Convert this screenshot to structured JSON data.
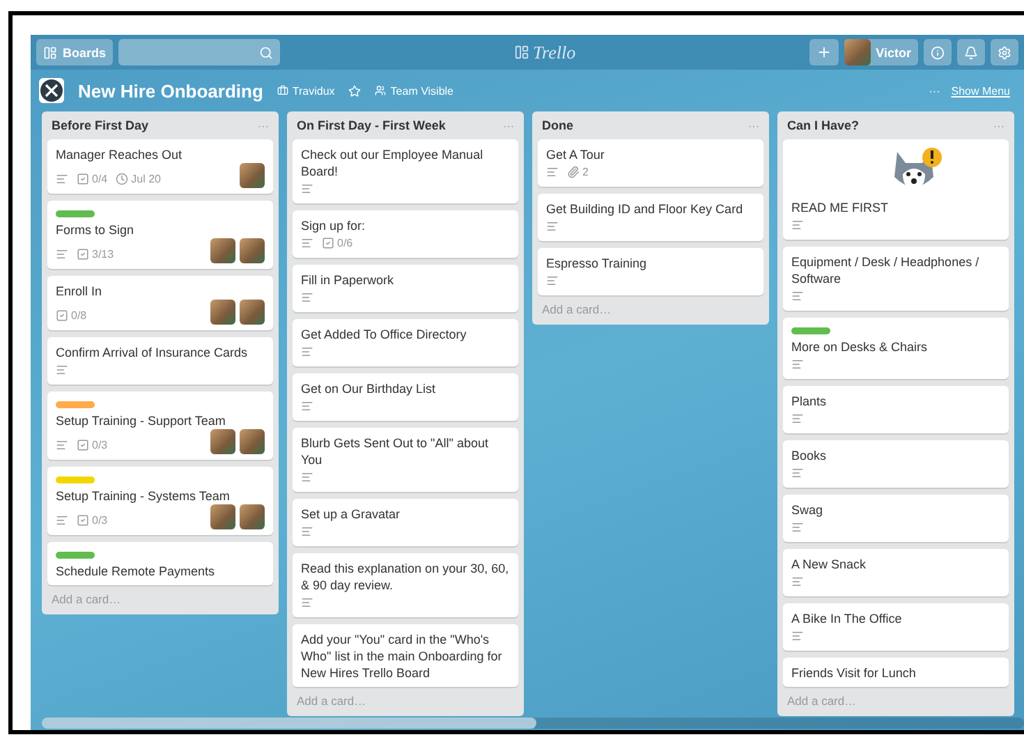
{
  "header": {
    "boards_button": "Boards",
    "logo": "Trello",
    "user": "Victor"
  },
  "board": {
    "title": "New Hire Onboarding",
    "team": "Travidux",
    "starred": false,
    "visibility": "Team Visible",
    "menu_dots": "···",
    "show_menu": "Show Menu"
  },
  "lists": [
    {
      "title": "Before First Day",
      "menu": "···",
      "add_card": "Add a card…",
      "cards": [
        {
          "title": "Manager Reaches Out",
          "description": true,
          "checklist": "0/4",
          "due": "Jul 20",
          "members": [
            {
              "kind": "photo"
            }
          ]
        },
        {
          "label": {
            "color": "#61bd4f"
          },
          "title": "Forms to Sign",
          "description": true,
          "checklist": "3/13",
          "members": [
            {
              "kind": "photo"
            },
            {
              "kind": "photo"
            }
          ]
        },
        {
          "title": "Enroll In",
          "description": false,
          "checklist": "0/8",
          "members": [
            {
              "kind": "photo"
            },
            {
              "kind": "photo"
            }
          ]
        },
        {
          "title": "Confirm Arrival of Insurance Cards",
          "description": true
        },
        {
          "label": {
            "color": "#ffab4a"
          },
          "title": "Setup Training - Support Team",
          "description": true,
          "checklist": "0/3",
          "members": [
            {
              "kind": "photo"
            },
            {
              "kind": "photo"
            }
          ]
        },
        {
          "label": {
            "color": "#f2d600"
          },
          "title": "Setup Training - Systems Team",
          "description": true,
          "checklist": "0/3",
          "members": [
            {
              "kind": "photo"
            },
            {
              "kind": "photo"
            }
          ]
        },
        {
          "label": {
            "color": "#61bd4f"
          },
          "title": "Schedule Remote Payments",
          "description": false
        }
      ]
    },
    {
      "title": "On First Day - First Week",
      "menu": "···",
      "add_card": "Add a card…",
      "cards": [
        {
          "title": "Check out our Employee Manual Board!",
          "description": true
        },
        {
          "title": "Sign up for:",
          "description": true,
          "checklist": "0/6"
        },
        {
          "title": "Fill in Paperwork",
          "description": true
        },
        {
          "title": "Get Added To Office Directory",
          "description": true
        },
        {
          "title": "Get on Our Birthday List",
          "description": true
        },
        {
          "title": "Blurb Gets Sent Out to \"All\" about You",
          "description": true
        },
        {
          "title": "Set up a Gravatar",
          "description": true
        },
        {
          "title": "Read this explanation on your 30, 60, & 90 day review.",
          "description": true
        },
        {
          "title": "Add your \"You\" card in the \"Who's Who\" list in the main Onboarding for New Hires Trello Board",
          "description": false
        }
      ]
    },
    {
      "title": "Done",
      "menu": "···",
      "add_card": "Add a card…",
      "cards": [
        {
          "title": "Get A Tour",
          "description": true,
          "attachments": "2"
        },
        {
          "title": "Get Building ID and Floor Key Card",
          "description": true
        },
        {
          "title": "Espresso Training",
          "description": true
        }
      ]
    },
    {
      "title": "Can I Have?",
      "menu": "···",
      "add_card": "Add a card…",
      "cards": [
        {
          "title": "READ ME FIRST",
          "description": true,
          "sticker": true
        },
        {
          "title": "Equipment / Desk / Headphones / Software",
          "description": true
        },
        {
          "label": {
            "color": "#61bd4f"
          },
          "title": "More on Desks & Chairs",
          "description": true
        },
        {
          "title": "Plants",
          "description": true
        },
        {
          "title": "Books",
          "description": true
        },
        {
          "title": "Swag",
          "description": true
        },
        {
          "title": "A New Snack",
          "description": true
        },
        {
          "title": "A Bike In The Office",
          "description": true
        },
        {
          "title": "Friends Visit for Lunch",
          "description": false
        }
      ]
    }
  ]
}
